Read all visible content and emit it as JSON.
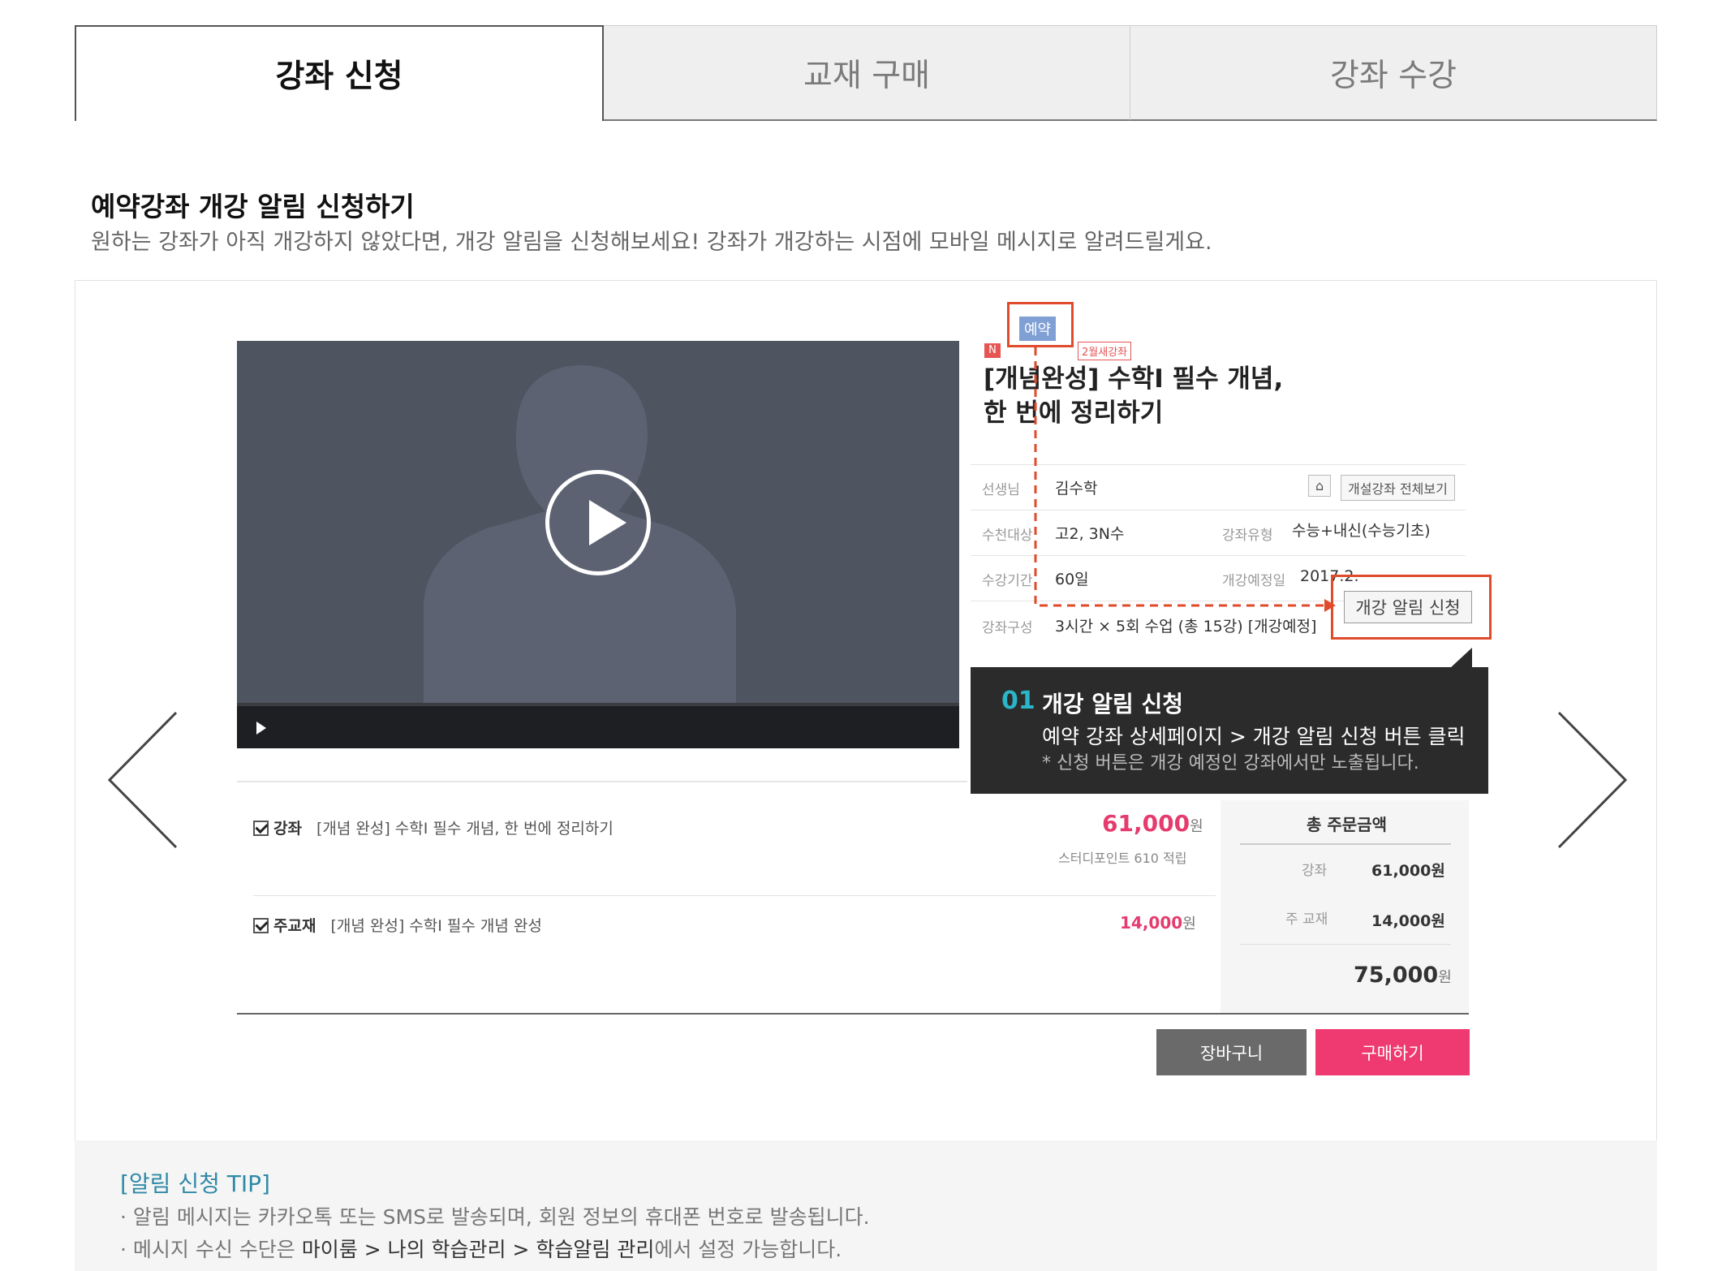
{
  "tabs": [
    {
      "label": "강좌 신청",
      "active": true
    },
    {
      "label": "교재 구매",
      "active": false
    },
    {
      "label": "강좌 수강",
      "active": false
    }
  ],
  "section": {
    "title": "예약강좌 개강 알림 신청하기",
    "description": "원하는 강좌가 아직 개강하지 않았다면, 개강 알림을 신청해보세요!  강좌가 개강하는 시점에 모바일 메시지로 알려드릴게요."
  },
  "course": {
    "badge_reserve": "예약",
    "badge_n": "N",
    "badge_new": "2월새강좌",
    "title_line1": "[개념완성] 수학Ⅰ 필수 개념,",
    "title_line2": "한 번에 정리하기",
    "teacher_label": "선생님",
    "teacher": "김수학",
    "all_courses_button": "개설강좌 전체보기",
    "target_label": "수천대상",
    "target": "고2, 3N수",
    "type_label": "강좌유형",
    "type": "수능+내신(수능기초)",
    "period_label": "수강기간",
    "period": "60일",
    "open_date_label": "개강예정일",
    "open_date": "2017.2.",
    "composition_label": "강좌구성",
    "composition": "3시간 × 5회 수업 (총 15강) [개강예정]",
    "notify_button": "개강 알림 신청"
  },
  "tooltip": {
    "number": "01",
    "title": "개강 알림 신청",
    "line1": "예약 강좌 상세페이지 > 개강 알림 신청 버튼 클릭",
    "line2": "* 신청 버튼은 개강 예정인 강좌에서만 노출됩니다."
  },
  "order": {
    "items": [
      {
        "category": "강좌",
        "name": "[개념 완성] 수학Ⅰ 필수 개념, 한 번에 정리하기",
        "price": "61,000",
        "won": "원",
        "points": "스터디포인트 610 적립"
      },
      {
        "category": "주교재",
        "name": "[개념 완성] 수학Ⅰ 필수 개념 완성",
        "price": "14,000",
        "won": "원"
      }
    ],
    "summary_title": "총 주문금액",
    "summary": [
      {
        "label": "강좌",
        "value": "61,000원"
      },
      {
        "label": "주 교재",
        "value": "14,000원"
      }
    ],
    "total": "75,000",
    "total_won": "원",
    "cart_button": "장바구니",
    "buy_button": "구매하기"
  },
  "tip": {
    "title": "[알림 신청 TIP]",
    "line1": "· 알림 메시지는 카카오톡 또는 SMS로 발송되며, 회원 정보의 휴대폰 번호로 발송됩니다.",
    "line2_pre": "· 메시지 수신 수단은 ",
    "line2_path": "마이룸 > 나의 학습관리 > 학습알림 관리",
    "line2_post": "에서 설정 가능합니다."
  },
  "colors": {
    "accent_pink": "#ee3a70",
    "highlight_red": "#e04b2c",
    "tooltip_number": "#2bb5c9"
  }
}
